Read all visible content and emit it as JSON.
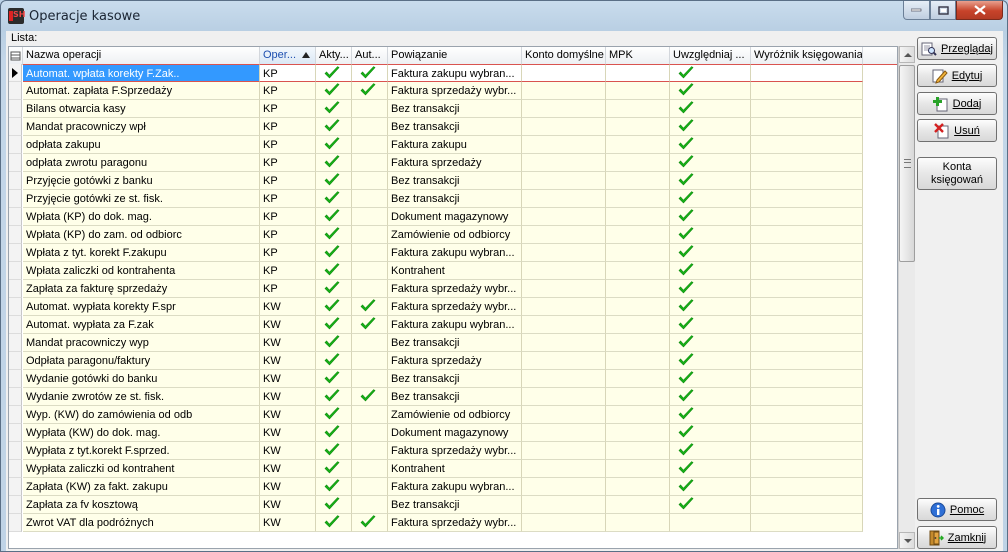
{
  "window": {
    "title": "Operacje kasowe"
  },
  "list_label": "Lista:",
  "columns": [
    {
      "label": "Nazwa operacji"
    },
    {
      "label": "Oper...",
      "sorted": "ascending"
    },
    {
      "label": "Akty..."
    },
    {
      "label": "Aut..."
    },
    {
      "label": "Powiązanie"
    },
    {
      "label": "Konto domyślne"
    },
    {
      "label": "MPK"
    },
    {
      "label": "Uwzględniaj ..."
    },
    {
      "label": "Wyróżnik księgowania"
    }
  ],
  "rows": [
    {
      "name": "Automat. wpłata korekty F.Zak..",
      "oper": "KP",
      "aktywna": true,
      "auto": true,
      "powiazanie": "Faktura zakupu wybran...",
      "uwzgledniaj": true,
      "selected": true
    },
    {
      "name": "Automat. zapłata F.Sprzedaży",
      "oper": "KP",
      "aktywna": true,
      "auto": true,
      "powiazanie": "Faktura sprzedaży wybr...",
      "uwzgledniaj": true
    },
    {
      "name": "Bilans otwarcia kasy",
      "oper": "KP",
      "aktywna": true,
      "auto": false,
      "powiazanie": "Bez transakcji",
      "uwzgledniaj": true
    },
    {
      "name": "Mandat pracowniczy wpł",
      "oper": "KP",
      "aktywna": true,
      "auto": false,
      "powiazanie": "Bez transakcji",
      "uwzgledniaj": true
    },
    {
      "name": "odpłata zakupu",
      "oper": "KP",
      "aktywna": true,
      "auto": false,
      "powiazanie": "Faktura zakupu",
      "uwzgledniaj": true
    },
    {
      "name": "odpłata zwrotu paragonu",
      "oper": "KP",
      "aktywna": true,
      "auto": false,
      "powiazanie": "Faktura sprzedaży",
      "uwzgledniaj": true
    },
    {
      "name": "Przyjęcie gotówki z banku",
      "oper": "KP",
      "aktywna": true,
      "auto": false,
      "powiazanie": "Bez transakcji",
      "uwzgledniaj": true
    },
    {
      "name": "Przyjęcie gotówki ze st. fisk.",
      "oper": "KP",
      "aktywna": true,
      "auto": false,
      "powiazanie": "Bez transakcji",
      "uwzgledniaj": true
    },
    {
      "name": "Wpłata (KP) do dok. mag.",
      "oper": "KP",
      "aktywna": true,
      "auto": false,
      "powiazanie": "Dokument magazynowy",
      "uwzgledniaj": true
    },
    {
      "name": "Wpłata (KP) do zam. od odbiorc",
      "oper": "KP",
      "aktywna": true,
      "auto": false,
      "powiazanie": "Zamówienie od odbiorcy",
      "uwzgledniaj": true
    },
    {
      "name": "Wpłata z tyt. korekt F.zakupu",
      "oper": "KP",
      "aktywna": true,
      "auto": false,
      "powiazanie": "Faktura zakupu wybran...",
      "uwzgledniaj": true
    },
    {
      "name": "Wpłata zaliczki od kontrahenta",
      "oper": "KP",
      "aktywna": true,
      "auto": false,
      "powiazanie": "Kontrahent",
      "uwzgledniaj": true
    },
    {
      "name": "Zapłata za fakturę sprzedaży",
      "oper": "KP",
      "aktywna": true,
      "auto": false,
      "powiazanie": "Faktura sprzedaży wybr...",
      "uwzgledniaj": true
    },
    {
      "name": "Automat. wypłata korekty F.spr",
      "oper": "KW",
      "aktywna": true,
      "auto": true,
      "powiazanie": "Faktura sprzedaży wybr...",
      "uwzgledniaj": true
    },
    {
      "name": "Automat. wypłata za F.zak",
      "oper": "KW",
      "aktywna": true,
      "auto": true,
      "powiazanie": "Faktura zakupu wybran...",
      "uwzgledniaj": true
    },
    {
      "name": "Mandat pracowniczy wyp",
      "oper": "KW",
      "aktywna": true,
      "auto": false,
      "powiazanie": "Bez transakcji",
      "uwzgledniaj": true
    },
    {
      "name": "Odpłata paragonu/faktury",
      "oper": "KW",
      "aktywna": true,
      "auto": false,
      "powiazanie": "Faktura sprzedaży",
      "uwzgledniaj": true
    },
    {
      "name": "Wydanie gotówki do banku",
      "oper": "KW",
      "aktywna": true,
      "auto": false,
      "powiazanie": "Bez transakcji",
      "uwzgledniaj": true
    },
    {
      "name": "Wydanie zwrotów ze st. fisk.",
      "oper": "KW",
      "aktywna": true,
      "auto": true,
      "powiazanie": "Bez transakcji",
      "uwzgledniaj": true
    },
    {
      "name": "Wyp. (KW) do zamówienia od odb",
      "oper": "KW",
      "aktywna": true,
      "auto": false,
      "powiazanie": "Zamówienie od odbiorcy",
      "uwzgledniaj": true
    },
    {
      "name": "Wypłata (KW) do dok. mag.",
      "oper": "KW",
      "aktywna": true,
      "auto": false,
      "powiazanie": "Dokument magazynowy",
      "uwzgledniaj": true
    },
    {
      "name": "Wypłata z tyt.korekt F.sprzed.",
      "oper": "KW",
      "aktywna": true,
      "auto": false,
      "powiazanie": "Faktura sprzedaży wybr...",
      "uwzgledniaj": true
    },
    {
      "name": "Wypłata zaliczki od kontrahent",
      "oper": "KW",
      "aktywna": true,
      "auto": false,
      "powiazanie": "Kontrahent",
      "uwzgledniaj": true
    },
    {
      "name": "Zapłata (KW) za fakt. zakupu",
      "oper": "KW",
      "aktywna": true,
      "auto": false,
      "powiazanie": "Faktura zakupu wybran...",
      "uwzgledniaj": true
    },
    {
      "name": "Zapłata za fv kosztową",
      "oper": "KW",
      "aktywna": true,
      "auto": false,
      "powiazanie": "Bez transakcji",
      "uwzgledniaj": true
    },
    {
      "name": "Zwrot VAT dla podróżnych",
      "oper": "KW",
      "aktywna": true,
      "auto": true,
      "powiazanie": "Faktura sprzedaży wybr...",
      "uwzgledniaj": false
    }
  ],
  "buttons": {
    "przegladaj": "Przeglądaj",
    "edytuj": "Edytuj",
    "dodaj": "Dodaj",
    "usun": "Usuń",
    "konta_line1": "Konta",
    "konta_line2": "księgowań",
    "pomoc": "Pomoc",
    "zamknij": "Zamknij"
  },
  "colors": {
    "row_bg": "#ffffe9",
    "selected_cell": "#3399ff",
    "check_green": "#17b317",
    "sorted_header_text": "#1d4fb0"
  }
}
